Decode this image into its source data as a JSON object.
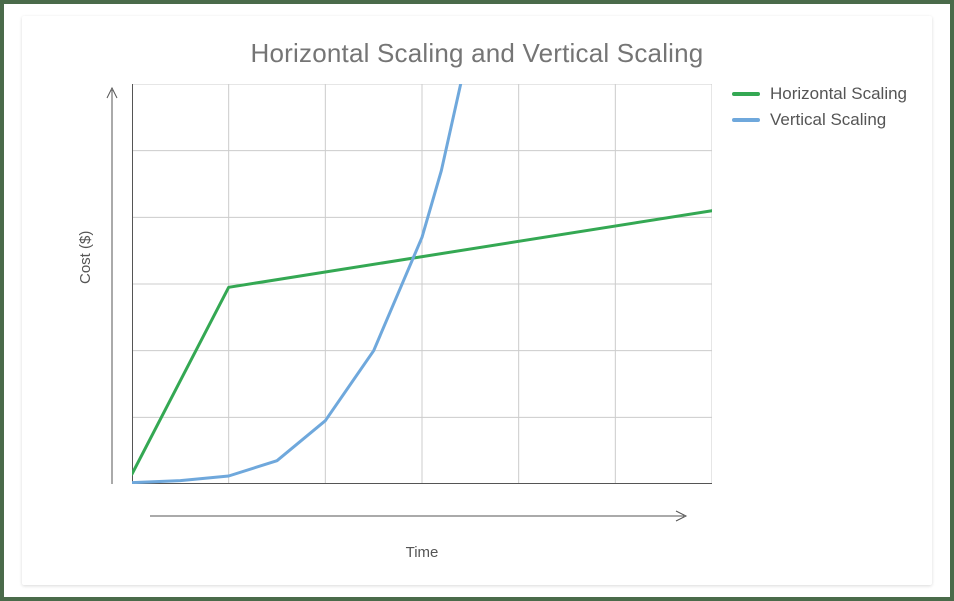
{
  "chart_data": {
    "type": "line",
    "title": "Horizontal Scaling and Vertical Scaling",
    "xlabel": "Time",
    "ylabel": "Cost ($)",
    "xlim": [
      0,
      6
    ],
    "ylim": [
      0,
      6
    ],
    "grid": true,
    "legend_position": "right",
    "series": [
      {
        "name": "Horizontal Scaling",
        "color": "#34a853",
        "x": [
          0,
          1,
          6
        ],
        "y": [
          0.15,
          2.95,
          4.1
        ]
      },
      {
        "name": "Vertical Scaling",
        "color": "#6fa8dc",
        "x": [
          0,
          0.5,
          1.0,
          1.5,
          2.0,
          2.5,
          3.0,
          3.2,
          3.4
        ],
        "y": [
          0.02,
          0.05,
          0.12,
          0.35,
          0.95,
          2.0,
          3.7,
          4.7,
          6.0
        ]
      }
    ]
  },
  "legend": {
    "items": [
      {
        "label": "Horizontal Scaling",
        "color": "#34a853"
      },
      {
        "label": "Vertical Scaling",
        "color": "#6fa8dc"
      }
    ]
  }
}
